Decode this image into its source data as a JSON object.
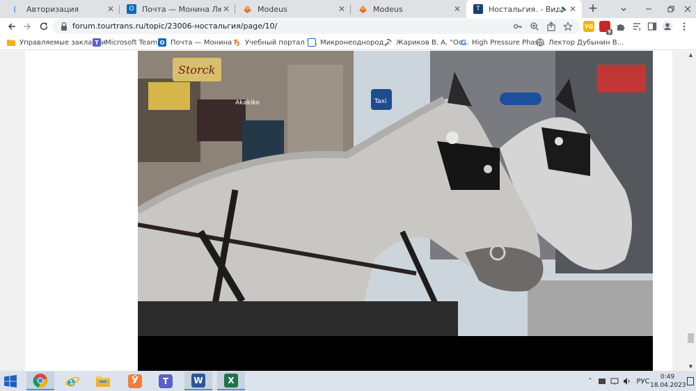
{
  "tabs": [
    {
      "title": "Авторизация",
      "favicon": "globe-blue-icon",
      "active": false
    },
    {
      "title": "Почта — Монина Людмила Н",
      "favicon": "outlook-icon",
      "active": false
    },
    {
      "title": "Modeus",
      "favicon": "modeus-icon",
      "active": false
    },
    {
      "title": "Modeus",
      "favicon": "modeus-icon",
      "active": false
    },
    {
      "title": "Ностальгия. - Видео - Фо",
      "favicon": "tourtrans-icon",
      "active": true
    }
  ],
  "toolbar": {
    "url": "forum.tourtrans.ru/topic/23006-ностальгия/page/10/"
  },
  "extensions": [
    {
      "name": "extension-yellow",
      "badge": "",
      "color": "#f5b400"
    },
    {
      "name": "extension-red",
      "badge": "9",
      "color": "#c62828"
    }
  ],
  "bookmarks": [
    {
      "label": "Управляемые закладки",
      "icon": "folder-icon",
      "color": "#f2b600"
    },
    {
      "label": "Microsoft Teams",
      "icon": "teams-icon",
      "color": "#5b5fc7"
    },
    {
      "label": "Почта — Монина...",
      "icon": "outlook-icon",
      "color": "#0f6cbd"
    },
    {
      "label": "Учебный портал Т...",
      "icon": "portal-icon",
      "color": "#e0701c"
    },
    {
      "label": "Микронеоднород...",
      "icon": "doc-icon",
      "color": "#1565c0"
    },
    {
      "label": "Жариков В. А. \"Ос...",
      "icon": "pickaxe-icon",
      "color": "#555555"
    },
    {
      "label": "High Pressure Phas...",
      "icon": "google-icon",
      "color": "#4285f4"
    },
    {
      "label": "Лектор Дубынин В...",
      "icon": "globe-icon",
      "color": "#777777"
    }
  ],
  "video": {
    "scene_signs": {
      "shop1": "Storck",
      "shop2": "Akakiko",
      "taxi": "Taxi"
    }
  },
  "taskbar": {
    "apps": [
      {
        "name": "chrome",
        "active": true
      },
      {
        "name": "internet-explorer",
        "active": false
      },
      {
        "name": "file-explorer",
        "active": false
      },
      {
        "name": "yandex",
        "active": false
      },
      {
        "name": "teams",
        "active": false
      },
      {
        "name": "word",
        "active": false
      },
      {
        "name": "excel",
        "active": false
      }
    ],
    "language": "РУС",
    "time": "0:49",
    "date": "18.04.2023"
  },
  "colors": {
    "tabstrip": "#dfe1e5",
    "taskbar": "#dde3ec",
    "accent": "#1a73e8"
  }
}
